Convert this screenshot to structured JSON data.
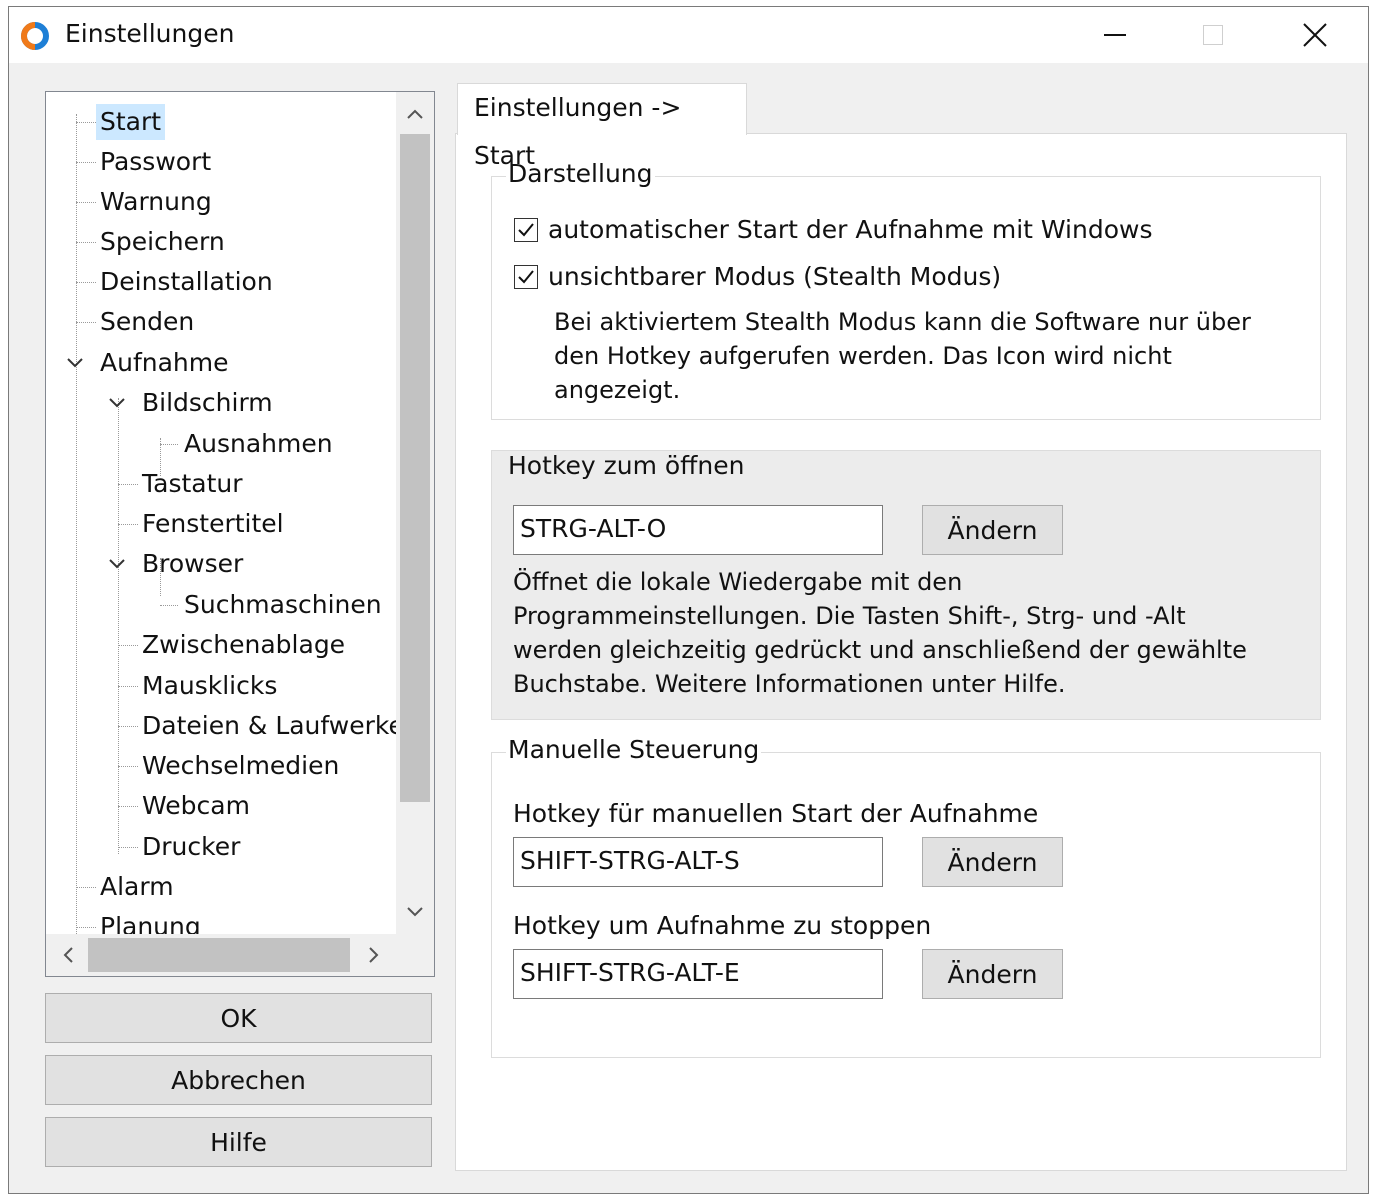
{
  "window": {
    "title": "Einstellungen"
  },
  "tree": {
    "items": [
      {
        "label": "Start",
        "selected": true
      },
      {
        "label": "Passwort"
      },
      {
        "label": "Warnung"
      },
      {
        "label": "Speichern"
      },
      {
        "label": "Deinstallation"
      },
      {
        "label": "Senden"
      },
      {
        "label": "Aufnahme",
        "expanded": true
      },
      {
        "label": "Bildschirm",
        "expanded": true
      },
      {
        "label": "Ausnahmen"
      },
      {
        "label": "Tastatur"
      },
      {
        "label": "Fenstertitel"
      },
      {
        "label": "Browser",
        "expanded": true
      },
      {
        "label": "Suchmaschinen"
      },
      {
        "label": "Zwischenablage"
      },
      {
        "label": "Mausklicks"
      },
      {
        "label": "Dateien & Laufwerke"
      },
      {
        "label": "Wechselmedien"
      },
      {
        "label": "Webcam"
      },
      {
        "label": "Drucker"
      },
      {
        "label": "Alarm"
      },
      {
        "label": "Planung"
      }
    ]
  },
  "buttons": {
    "ok": "OK",
    "cancel": "Abbrechen",
    "help": "Hilfe"
  },
  "tab": {
    "label": "Einstellungen -> Start"
  },
  "darstellung": {
    "title": "Darstellung",
    "autostart_label": "automatischer Start der Aufnahme mit Windows",
    "autostart_checked": true,
    "stealth_label": "unsichtbarer Modus (Stealth Modus)",
    "stealth_checked": true,
    "stealth_description": [
      "Bei aktiviertem Stealth Modus kann die Software nur über",
      "den Hotkey aufgerufen werden. Das Icon wird nicht",
      "angezeigt."
    ]
  },
  "hotkey_open": {
    "title": "Hotkey zum öffnen",
    "value": "STRG-ALT-O",
    "button": "Ändern",
    "description": [
      "Öffnet die lokale Wiedergabe mit den",
      "Programmeinstellungen. Die Tasten Shift-, Strg- und -Alt",
      "werden gleichzeitig gedrückt und anschließend der gewählte",
      "Buchstabe. Weitere Informationen unter Hilfe."
    ]
  },
  "manual": {
    "title": "Manuelle Steuerung",
    "start_label": "Hotkey für manuellen Start der Aufnahme",
    "start_value": "SHIFT-STRG-ALT-S",
    "start_button": "Ändern",
    "stop_label": "Hotkey um Aufnahme zu stoppen",
    "stop_value": "SHIFT-STRG-ALT-E",
    "stop_button": "Ändern"
  },
  "colors": {
    "selection": "#cce8ff",
    "window_bg": "#f0f0f0",
    "hotkey_group_bg": "#ececec"
  }
}
